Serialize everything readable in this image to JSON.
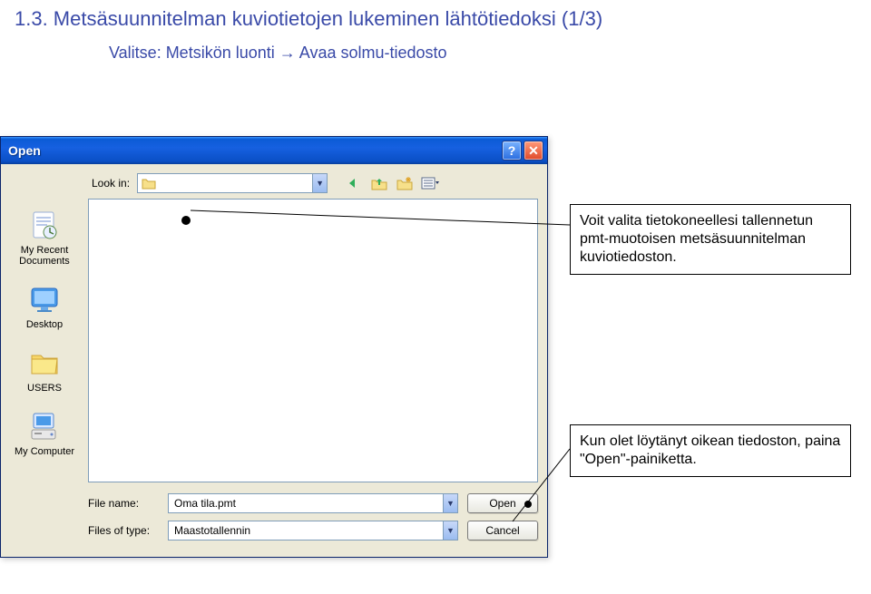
{
  "heading": "1.3. Metsäsuunnitelman kuviotietojen lukeminen lähtötiedoksi (1/3)",
  "subheading_prefix": "Valitse: Metsikön luonti ",
  "subheading_suffix": " Avaa solmu-tiedosto",
  "arrow": "→",
  "dialog": {
    "title": "Open",
    "lookin_label": "Look in:",
    "lookin_value": "",
    "places": [
      {
        "label": "My Recent Documents"
      },
      {
        "label": "Desktop"
      },
      {
        "label": "USERS"
      },
      {
        "label": "My Computer"
      }
    ],
    "filename_label": "File name:",
    "filename_value": "Oma tila.pmt",
    "filetype_label": "Files of type:",
    "filetype_value": "Maastotallennin",
    "open_label": "Open",
    "cancel_label": "Cancel"
  },
  "callouts": {
    "c1": "Voit valita tietokoneellesi tallennetun pmt-muotoisen metsäsuunnitelman kuviotiedoston.",
    "c2": "Kun olet löytänyt oikean tiedoston, paina \"Open\"-painiketta."
  }
}
